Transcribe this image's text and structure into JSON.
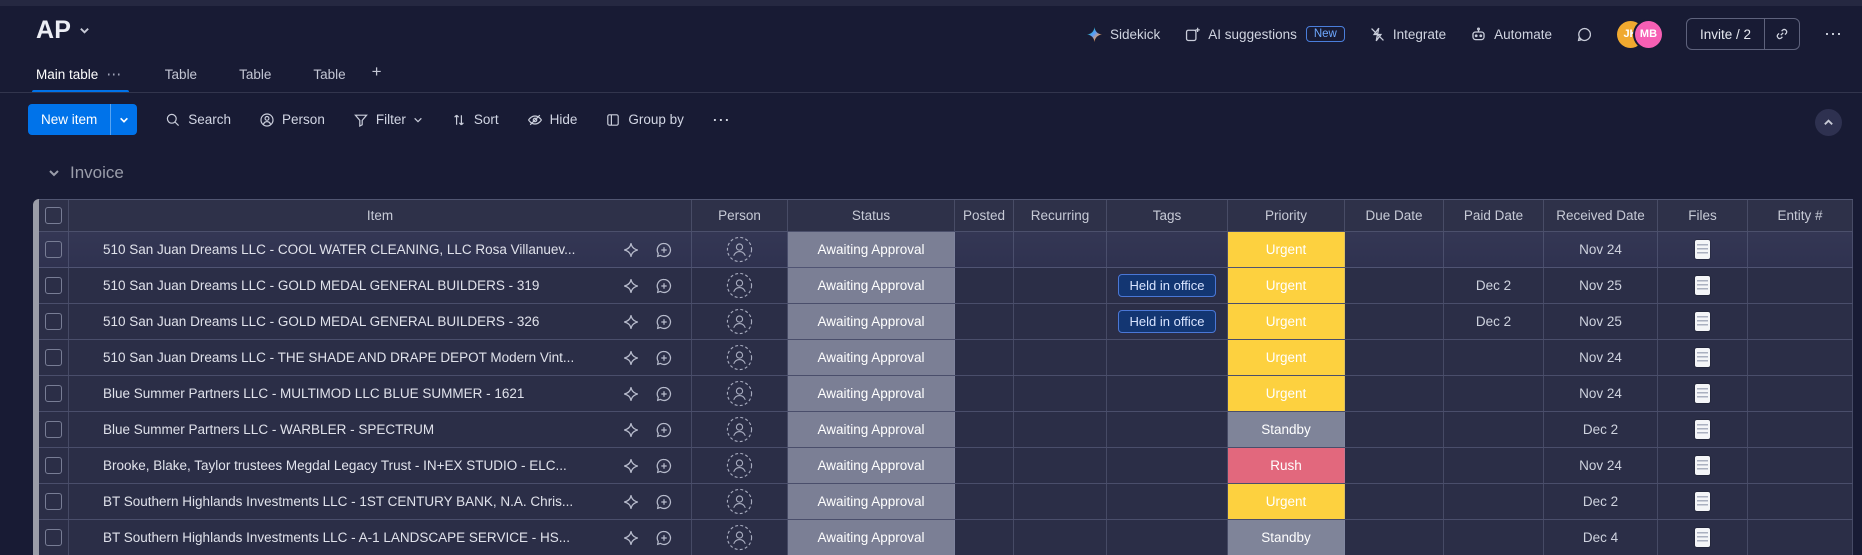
{
  "board": {
    "title": "AP"
  },
  "topbar": {
    "sidekick": "Sidekick",
    "ai_suggestions": "AI suggestions",
    "new_badge": "New",
    "integrate": "Integrate",
    "automate": "Automate",
    "avatars": [
      "JK",
      "MB"
    ],
    "invite_label": "Invite / 2",
    "more_icon": "⋯"
  },
  "tabs": {
    "items": [
      {
        "label": "Main table",
        "active": true
      },
      {
        "label": "Table",
        "active": false
      },
      {
        "label": "Table",
        "active": false
      },
      {
        "label": "Table",
        "active": false
      }
    ],
    "add_label": "+"
  },
  "toolbar": {
    "new_item": "New item",
    "search": "Search",
    "person": "Person",
    "filter": "Filter",
    "sort": "Sort",
    "hide": "Hide",
    "group_by": "Group by",
    "more_icon": "⋯"
  },
  "group": {
    "title": "Invoice"
  },
  "table": {
    "columns": [
      "Item",
      "Person",
      "Status",
      "Posted",
      "Recurring",
      "Tags",
      "Priority",
      "Due Date",
      "Paid Date",
      "Received Date",
      "Files",
      "Entity #"
    ],
    "rows": [
      {
        "item": "510 San Juan Dreams LLC - COOL WATER CLEANING, LLC Rosa Villanuev...",
        "status": "Awaiting Approval",
        "posted": "",
        "recurring": "",
        "tags": "",
        "priority": "Urgent",
        "due_date": "",
        "paid_date": "",
        "received_date": "Nov 24",
        "has_file": true,
        "entity": ""
      },
      {
        "item": "510 San Juan Dreams LLC - GOLD MEDAL GENERAL BUILDERS - 319",
        "status": "Awaiting Approval",
        "posted": "",
        "recurring": "",
        "tags": "Held in office",
        "priority": "Urgent",
        "due_date": "",
        "paid_date": "Dec 2",
        "received_date": "Nov 25",
        "has_file": true,
        "entity": ""
      },
      {
        "item": "510 San Juan Dreams LLC - GOLD MEDAL GENERAL BUILDERS - 326",
        "status": "Awaiting Approval",
        "posted": "",
        "recurring": "",
        "tags": "Held in office",
        "priority": "Urgent",
        "due_date": "",
        "paid_date": "Dec 2",
        "received_date": "Nov 25",
        "has_file": true,
        "entity": ""
      },
      {
        "item": "510 San Juan Dreams LLC - THE SHADE AND DRAPE DEPOT Modern Vint...",
        "status": "Awaiting Approval",
        "posted": "",
        "recurring": "",
        "tags": "",
        "priority": "Urgent",
        "due_date": "",
        "paid_date": "",
        "received_date": "Nov 24",
        "has_file": true,
        "entity": ""
      },
      {
        "item": "Blue Summer Partners LLC - MULTIMOD LLC BLUE SUMMER - 1621",
        "status": "Awaiting Approval",
        "posted": "",
        "recurring": "",
        "tags": "",
        "priority": "Urgent",
        "due_date": "",
        "paid_date": "",
        "received_date": "Nov 24",
        "has_file": true,
        "entity": ""
      },
      {
        "item": "Blue Summer Partners LLC - WARBLER - SPECTRUM",
        "status": "Awaiting Approval",
        "posted": "",
        "recurring": "",
        "tags": "",
        "priority": "Standby",
        "due_date": "",
        "paid_date": "",
        "received_date": "Dec 2",
        "has_file": true,
        "entity": ""
      },
      {
        "item": "Brooke, Blake, Taylor trustees Megdal Legacy Trust - IN+EX STUDIO - ELC...",
        "status": "Awaiting Approval",
        "posted": "",
        "recurring": "",
        "tags": "",
        "priority": "Rush",
        "due_date": "",
        "paid_date": "",
        "received_date": "Nov 24",
        "has_file": true,
        "entity": ""
      },
      {
        "item": "BT Southern Highlands Investments LLC - 1ST CENTURY BANK, N.A. Chris...",
        "status": "Awaiting Approval",
        "posted": "",
        "recurring": "",
        "tags": "",
        "priority": "Urgent",
        "due_date": "",
        "paid_date": "",
        "received_date": "Dec 2",
        "has_file": true,
        "entity": ""
      },
      {
        "item": "BT Southern Highlands Investments LLC - A-1 LANDSCAPE SERVICE - HS...",
        "status": "Awaiting Approval",
        "posted": "",
        "recurring": "",
        "tags": "",
        "priority": "Standby",
        "due_date": "",
        "paid_date": "",
        "received_date": "Dec 4",
        "has_file": true,
        "entity": ""
      }
    ]
  },
  "colors": {
    "accent": "#0073ea",
    "status_awaiting_approval": "#7b7f95",
    "priority": {
      "Urgent": "#fdd13f",
      "Standby": "#7f8499",
      "Rush": "#e2687d"
    },
    "tag_bg": "#133672",
    "tag_border": "#4a77d6",
    "avatar_jk": "#f0a92f",
    "avatar_mb": "#f65fb4",
    "group_bar": "#9b9da8"
  }
}
